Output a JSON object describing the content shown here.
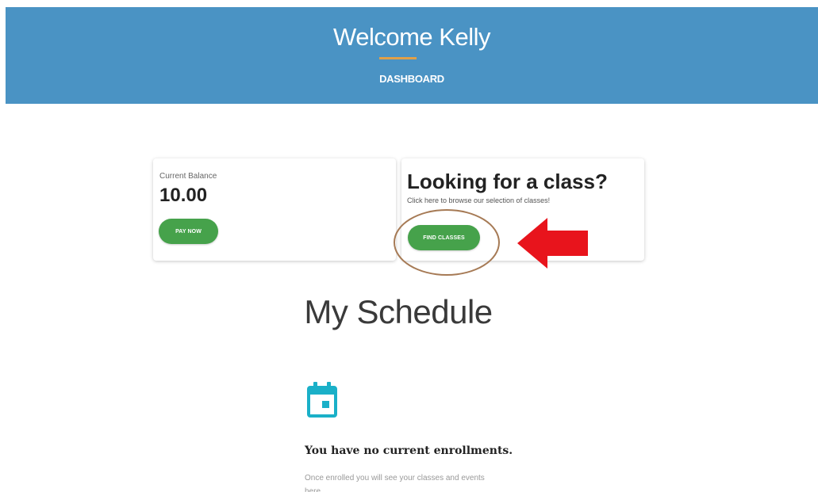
{
  "header": {
    "title": "Welcome Kelly",
    "nav_label": "DASHBOARD",
    "background_color": "#4a93c4",
    "divider_color": "#e0a048"
  },
  "balance_card": {
    "label": "Current Balance",
    "value": "10.00",
    "button_label": "PAY NOW"
  },
  "classes_card": {
    "heading": "Looking for a class?",
    "subtext": "Click here to browse our selection of classes!",
    "button_label": "FIND CLASSES"
  },
  "schedule": {
    "title": "My Schedule",
    "icon": "calendar-icon",
    "empty_title": "You have no current enrollments.",
    "empty_description": "Once enrolled you will see your classes and events here."
  },
  "annotations": {
    "circle_color": "#a67a55",
    "arrow_color": "#e8141c"
  },
  "colors": {
    "button_green": "#46a24b",
    "icon_teal": "#1ab0c8"
  }
}
